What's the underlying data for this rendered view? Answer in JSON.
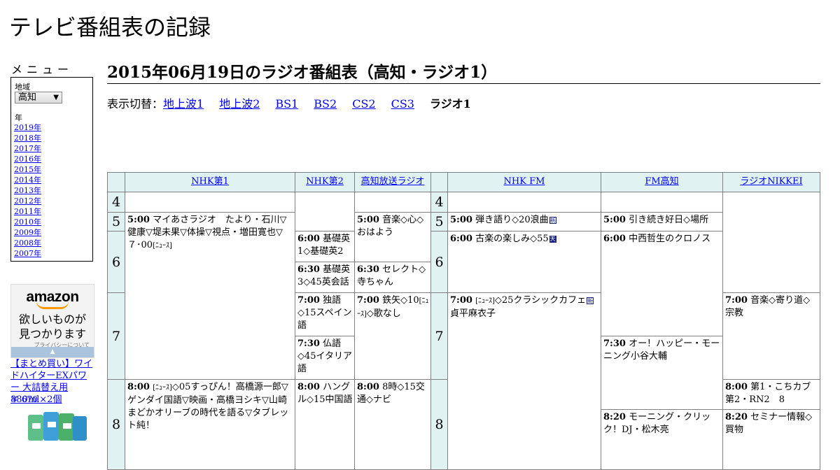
{
  "site": {
    "title": "テレビ番組表の記録"
  },
  "sidebar": {
    "menu_label": "メニュー",
    "region_label": "地域",
    "region_value": "高知",
    "year_label": "年",
    "years": [
      "2019年",
      "2018年",
      "2017年",
      "2016年",
      "2015年",
      "2014年",
      "2013年",
      "2012年",
      "2011年",
      "2010年",
      "2009年",
      "2008年",
      "2007年"
    ]
  },
  "ad": {
    "brand": "amazon",
    "copy_line1": "欲しいものが",
    "copy_line2": "見つかります",
    "privacy": "プライバシーについて",
    "collapse_glyph": "▲",
    "product_title": "【まとめ買い】ワイドハイターEXパワー 大詰替え用880ml×2個",
    "price": "￥ 670"
  },
  "page": {
    "heading": "2015年06月19日のラジオ番組表（高知・ラジオ1）",
    "switch_label": "表示切替：",
    "tabs": [
      "地上波1",
      "地上波2",
      "BS1",
      "BS2",
      "CS2",
      "CS3"
    ],
    "current_tab": "ラジオ1"
  },
  "schedule": {
    "channels": [
      "NHK第1",
      "NHK第2",
      "高知放送ラジオ",
      "NHK FM",
      "FM高知",
      "ラジオNIKKEI"
    ],
    "hours": [
      "4",
      "5",
      "6",
      "7",
      "8"
    ],
    "programs": {
      "nhk1_0500": {
        "time": "5:00",
        "title": "マイあさラジオ　たより・石川▽健康▽堤未果▽体操▽視点・増田寛也▽７･00",
        "note": "[ﾆｭｰｽ]"
      },
      "nhk1_0800": {
        "time": "8:00",
        "note": "[ﾆｭｰｽ]",
        "title": "◇05すっぴん！高橋源一郎▽ゲンダイ国語▽映画・高橋ヨシキ▽山崎まどかオリーブの時代を語る▽タブレット純！"
      },
      "nhk2_0600": {
        "time": "6:00",
        "title": "基礎英1◇基礎英2"
      },
      "nhk2_0630": {
        "time": "6:30",
        "title": "基礎英3◇45英会話"
      },
      "nhk2_0700": {
        "time": "7:00",
        "title": "独語◇15スペイン語"
      },
      "nhk2_0730": {
        "time": "7:30",
        "title": "仏語◇45イタリア語"
      },
      "nhk2_0800": {
        "time": "8:00",
        "title": "ハングル◇15中国語"
      },
      "rkc_0500": {
        "time": "5:00",
        "title": "音楽◇心◇おはよう"
      },
      "rkc_0630": {
        "time": "6:30",
        "title": "セレクト◇寺ちゃん"
      },
      "rkc_0700": {
        "time": "7:00",
        "title": "鉄矢◇10",
        "note": "[ﾆｭｰｽ]",
        "title2": "◇歌なし"
      },
      "rkc_0800": {
        "time": "8:00",
        "title": "8時◇15交通◇ナビ"
      },
      "fm_0500": {
        "time": "5:00",
        "title": "弾き語り◇20浪曲",
        "mark": "新"
      },
      "fm_0600": {
        "time": "6:00",
        "title": "古楽の楽しみ◇55",
        "mark": "天"
      },
      "fm_0700": {
        "time": "7:00",
        "note": "[ﾆｭｰｽ]",
        "title": "◇25クラシックカフェ",
        "mark": "新",
        "title2": "貞平麻衣子"
      },
      "fmk_0500": {
        "time": "5:00",
        "title": "引き続き好日◇場所"
      },
      "fmk_0600": {
        "time": "6:00",
        "title": "中西哲生のクロノス"
      },
      "fmk_0730": {
        "time": "7:30",
        "title": "オー！ハッピー・モーニング小谷大輔"
      },
      "fmk_0820": {
        "time": "8:20",
        "title": "モーニング・クリック！DJ・松木亮"
      },
      "nikkei_0700": {
        "time": "7:00",
        "title": "音楽◇寄り道◇宗教"
      },
      "nikkei_0800": {
        "time": "8:00",
        "title": "第1・こちカブ第2・RN2　8"
      },
      "nikkei_0820": {
        "time": "8:20",
        "title": "セミナー情報◇買物"
      }
    }
  }
}
